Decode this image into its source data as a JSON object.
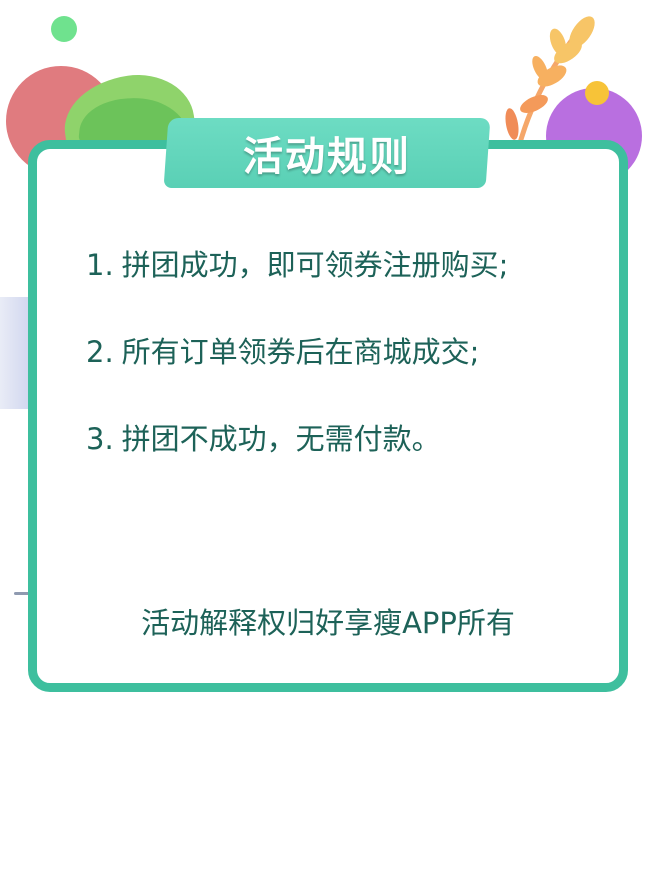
{
  "header": {
    "title": "活动规则"
  },
  "rules": [
    {
      "number": "1.",
      "text": "拼团成功，即可领券注册购买;"
    },
    {
      "number": "2.",
      "text": "所有订单领券后在商城成交;"
    },
    {
      "number": "3.",
      "text": "拼团不成功，无需付款。"
    }
  ],
  "footer": {
    "note": "活动解释权归好享瘦APP所有"
  },
  "colors": {
    "card_border": "#3ebf9e",
    "header_fill": "#5ad0b5",
    "text": "#1d6258",
    "deco_green_dot": "#6fe28e",
    "deco_red": "#e07b7f",
    "deco_purple": "#b96fe0",
    "deco_yellow": "#f7c338"
  },
  "icons": {
    "decorations": [
      "green-dot",
      "red-circle",
      "leaf",
      "plant",
      "purple-circle",
      "yellow-dot"
    ]
  }
}
